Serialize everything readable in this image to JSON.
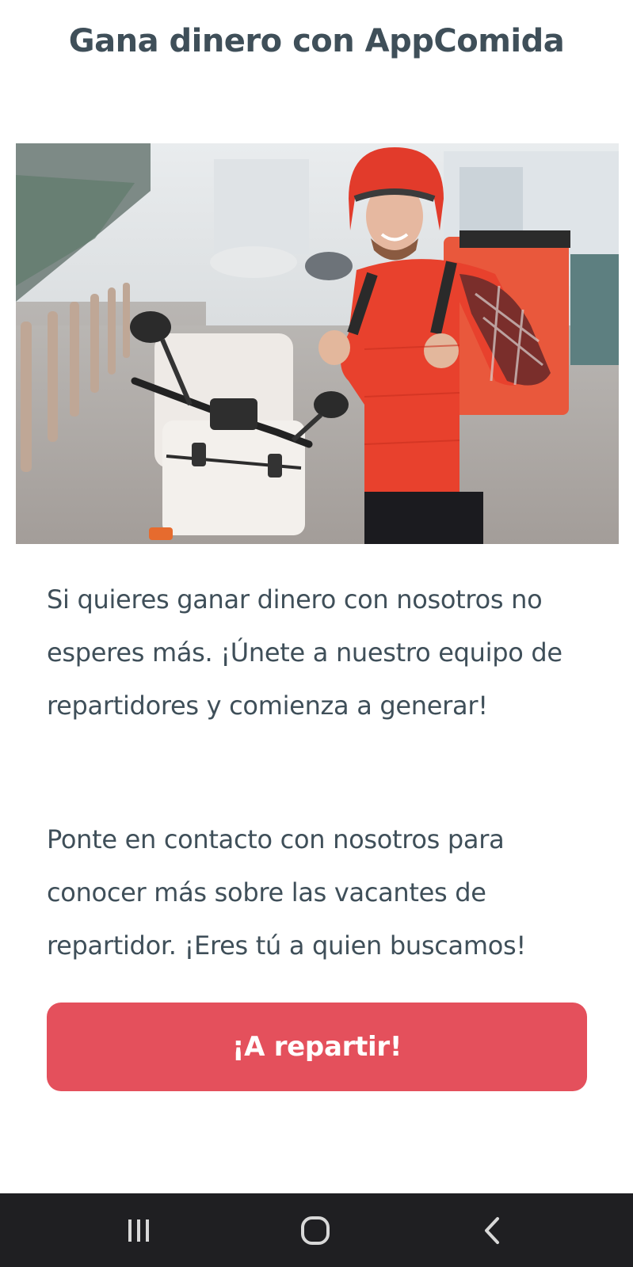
{
  "header": {
    "title": "Gana dinero con AppComida"
  },
  "hero": {
    "image_description_icon": "delivery-courier-photo"
  },
  "content": {
    "paragraph_1": "Si quieres ganar dinero con nosotros no esperes más. ¡Únete a nuestro equipo de repartidores y comienza a generar!",
    "paragraph_2": "Ponte en contacto con nosotros para conocer más sobre las vacantes de repartidor. ¡Eres tú a quien buscamos!"
  },
  "cta": {
    "label": "¡A repartir!",
    "color": "#e4505c"
  },
  "navbar": {
    "recent_icon": "recent-apps-icon",
    "home_icon": "home-icon",
    "back_icon": "back-icon",
    "background": "#1f1f22"
  },
  "colors": {
    "text": "#3f4f59",
    "accent": "#e4505c"
  }
}
